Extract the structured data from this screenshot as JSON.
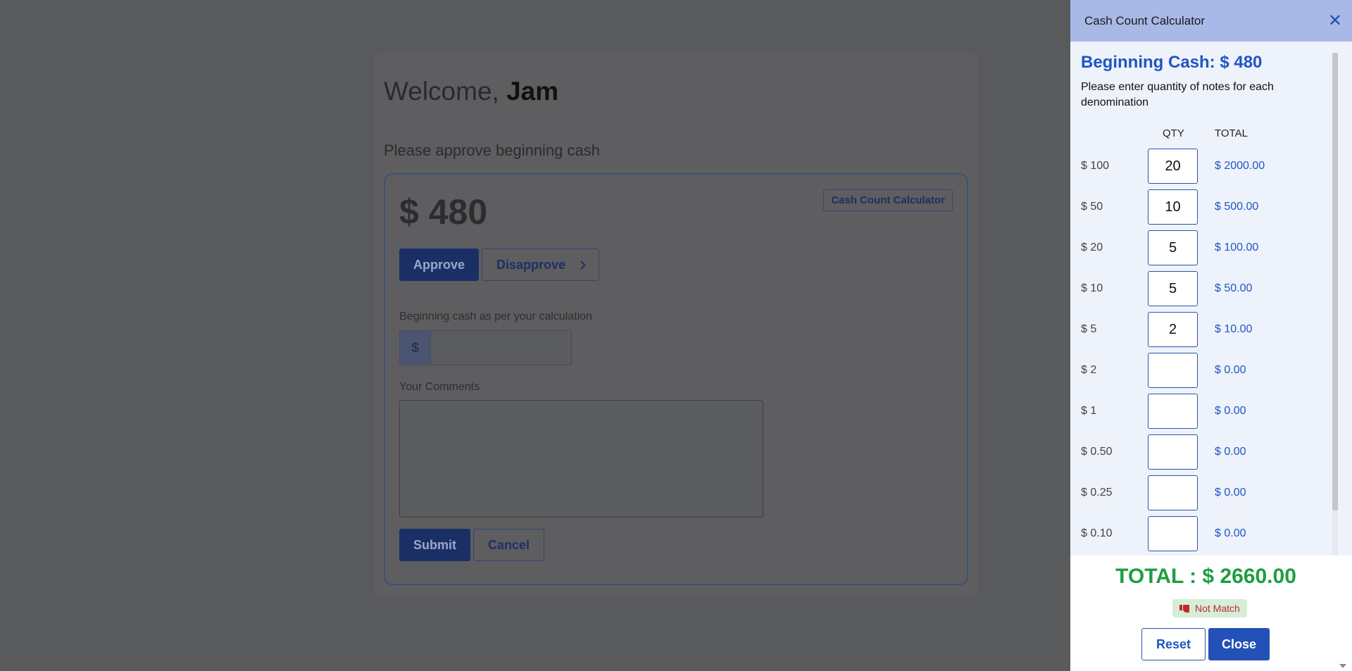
{
  "page": {
    "welcome_prefix": "Welcome,",
    "user_name": "Jam",
    "approve_prompt": "Please approve beginning cash",
    "amount": "$ 480",
    "calculator_button": "Cash Count Calculator",
    "approve_label": "Approve",
    "disapprove_label": "Disapprove",
    "cash_field_label": "Beginning cash as per your calculation",
    "currency_symbol": "$",
    "comments_label": "Your Comments",
    "submit_label": "Submit",
    "cancel_label": "Cancel"
  },
  "drawer": {
    "title": "Cash Count Calculator",
    "close_glyph": "✕",
    "beginning_cash": "Beginning Cash: $ 480",
    "instructions": "Please enter quantity of notes for each denomination",
    "qty_header": "QTY",
    "total_header": "TOTAL",
    "denominations": [
      {
        "label": "$ 100",
        "qty": "20",
        "total": "$ 2000.00"
      },
      {
        "label": "$ 50",
        "qty": "10",
        "total": "$ 500.00"
      },
      {
        "label": "$ 20",
        "qty": "5",
        "total": "$ 100.00"
      },
      {
        "label": "$ 10",
        "qty": "5",
        "total": "$ 50.00"
      },
      {
        "label": "$ 5",
        "qty": "2",
        "total": "$ 10.00"
      },
      {
        "label": "$ 2",
        "qty": "",
        "total": "$ 0.00"
      },
      {
        "label": "$ 1",
        "qty": "",
        "total": "$ 0.00"
      },
      {
        "label": "$ 0.50",
        "qty": "",
        "total": "$ 0.00"
      },
      {
        "label": "$ 0.25",
        "qty": "",
        "total": "$ 0.00"
      },
      {
        "label": "$ 0.10",
        "qty": "",
        "total": "$ 0.00"
      }
    ],
    "grand_total": "TOTAL : $ 2660.00",
    "match_status": "Not Match",
    "reset_label": "Reset",
    "close_label": "Close"
  },
  "colors": {
    "accent": "#1e56c4",
    "header_bg": "#a8b9e7",
    "total_green": "#1e9e3f",
    "mismatch_red": "#c0292b"
  }
}
